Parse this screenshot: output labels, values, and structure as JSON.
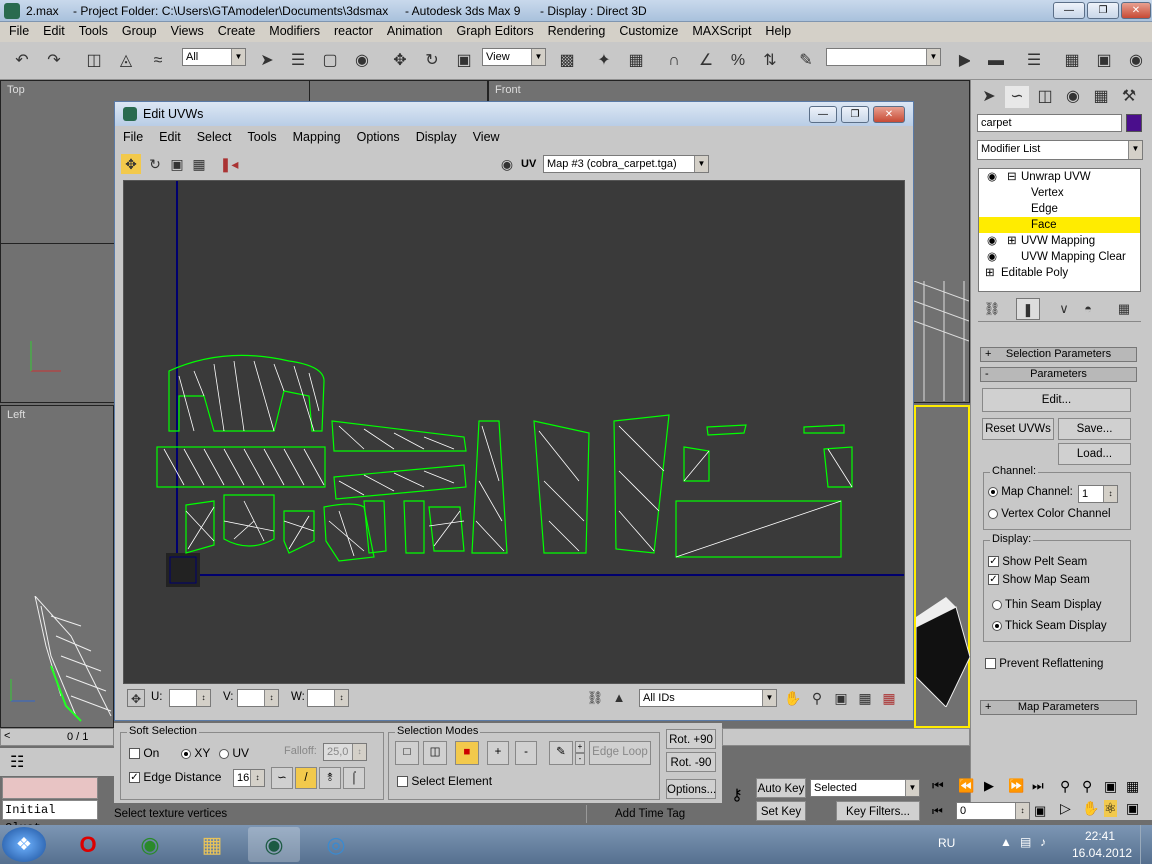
{
  "window": {
    "title_file": "2.max",
    "title_folder": "- Project Folder: C:\\Users\\GTAmodeler\\Documents\\3dsmax",
    "title_app": "- Autodesk 3ds Max 9",
    "title_display": "- Display : Direct 3D"
  },
  "menu": [
    "File",
    "Edit",
    "Tools",
    "Group",
    "Views",
    "Create",
    "Modifiers",
    "reactor",
    "Animation",
    "Graph Editors",
    "Rendering",
    "Customize",
    "MAXScript",
    "Help"
  ],
  "toolbar": {
    "selection_filter": "All",
    "ref_coord": "View"
  },
  "viewports": {
    "top": "Top",
    "front": "Front",
    "left": "Left"
  },
  "uvw": {
    "title": "Edit UVWs",
    "menu": [
      "File",
      "Edit",
      "Select",
      "Tools",
      "Mapping",
      "Options",
      "Display",
      "View"
    ],
    "uv_label": "UV",
    "map": "Map #3 (cobra_carpet.tga)",
    "u_label": "U:",
    "v_label": "V:",
    "w_label": "W:",
    "ids": "All IDs"
  },
  "soft_selection": {
    "title": "Soft Selection",
    "on": "On",
    "xy": "XY",
    "uv": "UV",
    "falloff_label": "Falloff:",
    "falloff_value": "25,0",
    "edge_distance": "Edge Distance",
    "edge_value": "16"
  },
  "selection_modes": {
    "title": "Selection Modes",
    "edge_loop": "Edge Loop",
    "select_element": "Select Element",
    "rot_plus": "Rot. +90",
    "rot_minus": "Rot. -90",
    "options": "Options..."
  },
  "command_panel": {
    "object_name": "carpet",
    "object_color": "#4a0e8c",
    "modifier_list": "Modifier List",
    "stack": [
      {
        "label": "Unwrap UVW"
      },
      {
        "label": "Vertex"
      },
      {
        "label": "Edge"
      },
      {
        "label": "Face"
      },
      {
        "label": "UVW Mapping"
      },
      {
        "label": "UVW Mapping Clear"
      },
      {
        "label": "Editable Poly"
      }
    ],
    "selection_parameters": "Selection Parameters",
    "parameters": "Parameters",
    "edit": "Edit...",
    "reset_uvws": "Reset UVWs",
    "save": "Save...",
    "load": "Load...",
    "channel": "Channel:",
    "map_channel": "Map Channel:",
    "map_channel_value": "1",
    "vertex_color_channel": "Vertex Color Channel",
    "display": "Display:",
    "show_pelt_seam": "Show Pelt Seam",
    "show_map_seam": "Show Map Seam",
    "thin_seam": "Thin Seam Display",
    "thick_seam": "Thick Seam Display",
    "prevent_reflattening": "Prevent Reflattening",
    "map_parameters": "Map Parameters"
  },
  "timeline": {
    "counter": "0 / 1"
  },
  "status": {
    "maxscript": "Initial Clust",
    "prompt": "Select texture vertices",
    "add_time_tag": "Add Time Tag",
    "auto_key": "Auto Key",
    "set_key": "Set Key",
    "selected": "Selected",
    "key_filters": "Key Filters...",
    "frame": "0"
  },
  "taskbar": {
    "lang": "RU",
    "time": "22:41",
    "date": "16.04.2012"
  },
  "colors": {
    "highlight": "#ffec00",
    "wire": "#00ff00",
    "canvas": "#3a3a3a"
  }
}
